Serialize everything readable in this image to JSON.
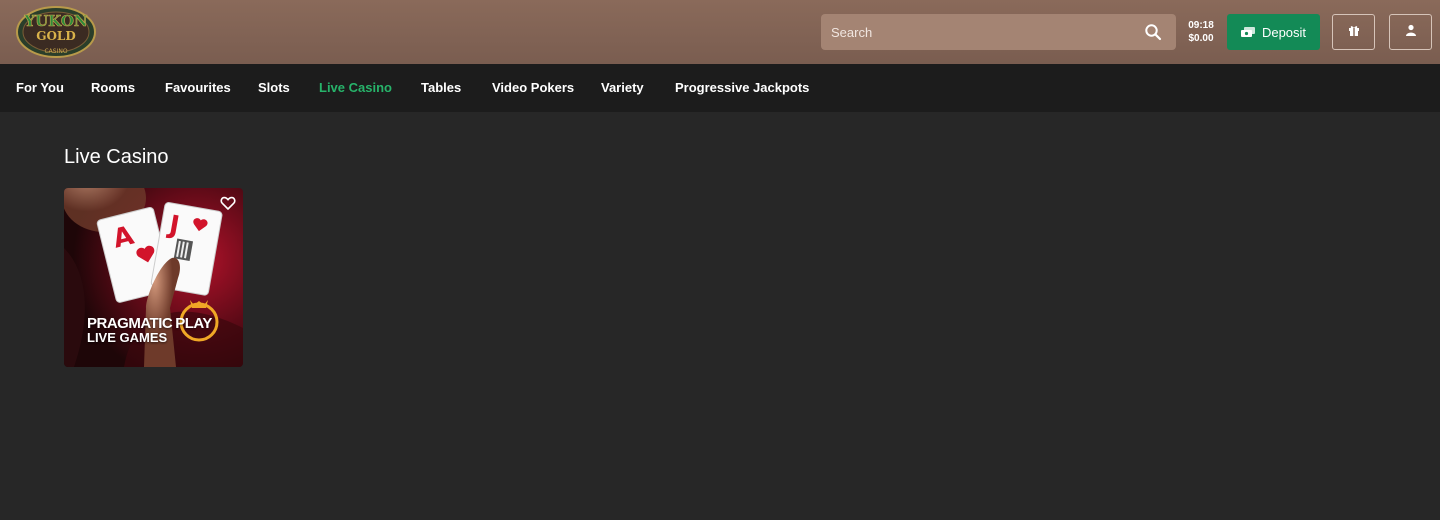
{
  "header": {
    "logo": {
      "line1": "YUKON",
      "line2": "GOLD",
      "line3": "CASINO"
    },
    "search": {
      "placeholder": "Search",
      "icon": "search-icon"
    },
    "clock": {
      "time": "09:18",
      "balance": "$0.00"
    },
    "deposit_label": "Deposit",
    "buttons": {
      "gift": "gift-icon",
      "account": "user-icon"
    }
  },
  "nav": {
    "items": [
      {
        "label": "For You"
      },
      {
        "label": "Rooms"
      },
      {
        "label": "Favourites"
      },
      {
        "label": "Slots"
      },
      {
        "label": "Live Casino"
      },
      {
        "label": "Tables"
      },
      {
        "label": "Video Pokers"
      },
      {
        "label": "Variety"
      },
      {
        "label": "Progressive Jackpots"
      }
    ],
    "active": "Live Casino"
  },
  "main": {
    "title": "Live Casino",
    "games": [
      {
        "brand_line1": "PRAGMATIC",
        "brand_line2": "PLAY",
        "brand_line3": "LIVE GAMES",
        "card1": "A",
        "card2": "J"
      }
    ]
  },
  "colors": {
    "header_bg": "#7f6253",
    "nav_bg": "#1c1c1c",
    "page_bg": "#272727",
    "accent_green": "#27b36a",
    "deposit_green": "#138a56"
  }
}
